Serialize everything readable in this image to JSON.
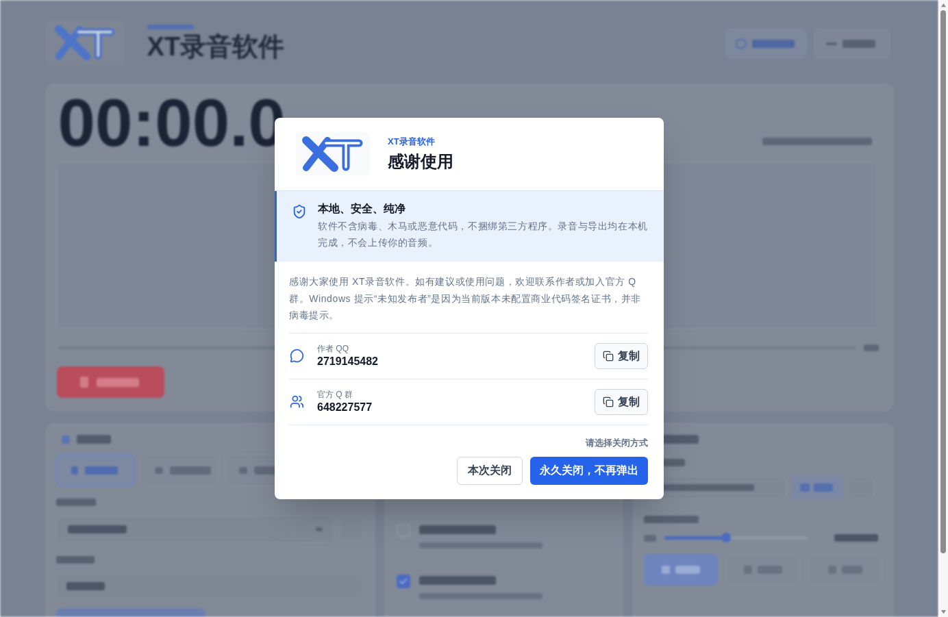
{
  "background": {
    "app_title": "XT录音软件",
    "timer": "00:00.0",
    "tabs": [
      {
        "selected": true
      },
      {
        "selected": false
      },
      {
        "selected": false
      }
    ],
    "checkboxes": [
      {
        "checked": false
      },
      {
        "checked": true
      }
    ],
    "bitrate_slider": {
      "level": 0.43
    }
  },
  "dialog": {
    "eyebrow": "XT录音软件",
    "title": "感谢使用",
    "notice": {
      "title": "本地、安全、纯净",
      "text": "软件不含病毒、木马或恶意代码，不捆绑第三方程序。录音与导出均在本机完成，不会上传你的音频。"
    },
    "message": "感谢大家使用 XT录音软件。如有建议或使用问题，欢迎联系作者或加入官方 Q 群。Windows 提示“未知发布者”是因为当前版本未配置商业代码签名证书，并非病毒提示。",
    "contacts": [
      {
        "kind": "chat",
        "label": "作者 QQ",
        "value": "2719145482",
        "button": "复制"
      },
      {
        "kind": "group",
        "label": "官方 Q 群",
        "value": "648227577",
        "button": "复制"
      }
    ],
    "close_prompt": "请选择关闭方式",
    "buttons": [
      {
        "kind": "secondary",
        "label": "本次关闭"
      },
      {
        "kind": "primary",
        "label": "永久关闭，不再弹出"
      }
    ]
  }
}
